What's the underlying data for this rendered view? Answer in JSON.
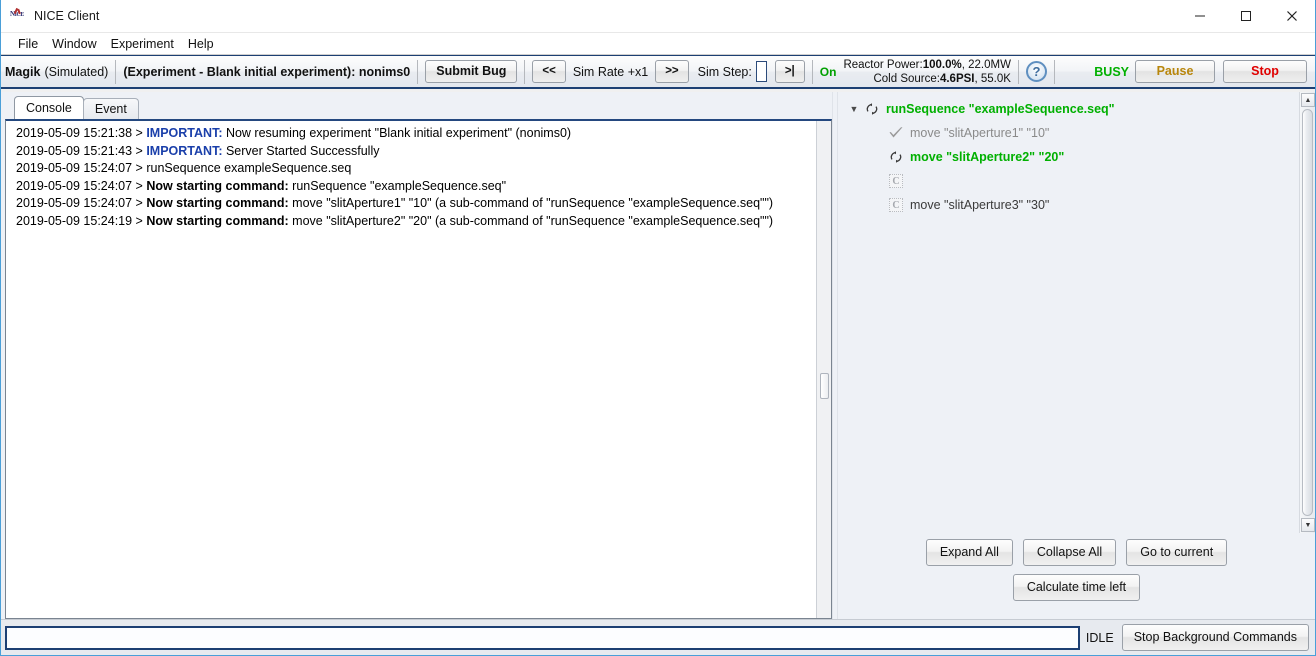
{
  "window": {
    "title": "NICE Client",
    "app_icon": "nice-logo-icon",
    "controls": {
      "minimize": "minimize-icon",
      "maximize": "maximize-icon",
      "close": "close-icon"
    }
  },
  "menubar": {
    "items": [
      "File",
      "Window",
      "Experiment",
      "Help"
    ]
  },
  "toolbar": {
    "instrument_name": "Magik",
    "instrument_mode": "(Simulated)",
    "experiment": "(Experiment - Blank initial experiment): nonims0",
    "submit_bug_label": "Submit Bug",
    "rate_back_label": "<<",
    "sim_rate_label": "Sim Rate +x1",
    "rate_fwd_label": ">>",
    "sim_step_label": "Sim Step:",
    "sim_step_value": "",
    "step_once_label": ">|",
    "on_status": "On",
    "reactor_power_label": "Reactor Power:",
    "reactor_power_value": "100.0%",
    "reactor_power_extra": ", 22.0MW",
    "cold_source_label": "Cold Source:",
    "cold_source_value": "4.6PSI",
    "cold_source_extra": ", 55.0K",
    "help_icon": "?",
    "busy_status": "BUSY",
    "pause_label": "Pause",
    "stop_label": "Stop",
    "colors": {
      "on": "#00a000",
      "busy": "#00b000",
      "pause": "#b8860b",
      "stop": "#e00000"
    }
  },
  "console": {
    "tabs": [
      {
        "label": "Console",
        "selected": true
      },
      {
        "label": "Event",
        "selected": false
      }
    ],
    "lines": [
      {
        "timestamp": "2019-05-09 15:21:38 > ",
        "tag": "IMPORTANT:",
        "bold": "",
        "rest": " Now resuming experiment \"Blank initial experiment\" (nonims0)"
      },
      {
        "timestamp": "2019-05-09 15:21:43 > ",
        "tag": "IMPORTANT:",
        "bold": "",
        "rest": " Server Started Successfully"
      },
      {
        "timestamp": "2019-05-09 15:24:07 > ",
        "tag": "",
        "bold": "",
        "rest": "runSequence exampleSequence.seq"
      },
      {
        "timestamp": "2019-05-09 15:24:07 > ",
        "tag": "",
        "bold": "Now starting command:",
        "rest": " runSequence \"exampleSequence.seq\""
      },
      {
        "timestamp": "2019-05-09 15:24:07 > ",
        "tag": "",
        "bold": "Now starting command:",
        "rest": " move \"slitAperture1\" \"10\" (a sub-command of \"runSequence \"exampleSequence.seq\"\")"
      },
      {
        "timestamp": "2019-05-09 15:24:19 > ",
        "tag": "",
        "bold": "Now starting command:",
        "rest": " move \"slitAperture2\" \"20\" (a sub-command of \"runSequence \"exampleSequence.seq\"\")"
      }
    ]
  },
  "tree": {
    "rows": [
      {
        "indent": 1,
        "twisty": "▼",
        "icon": "running-spinner-icon",
        "label": "runSequence \"exampleSequence.seq\"",
        "state": "running"
      },
      {
        "indent": 2,
        "twisty": "",
        "icon": "check-done-icon",
        "label": "move \"slitAperture1\" \"10\"",
        "state": "done"
      },
      {
        "indent": 2,
        "twisty": "",
        "icon": "running-spinner-icon",
        "label": "move \"slitAperture2\" \"20\"",
        "state": "running"
      },
      {
        "indent": 2,
        "twisty": "",
        "icon": "pending-command-icon",
        "label": "",
        "state": "pending"
      },
      {
        "indent": 2,
        "twisty": "",
        "icon": "pending-command-icon",
        "label": "move \"slitAperture3\" \"30\"",
        "state": "pending"
      }
    ],
    "buttons": {
      "expand_all": "Expand All",
      "collapse_all": "Collapse All",
      "go_to_current": "Go to current",
      "calculate_time_left": "Calculate time left"
    }
  },
  "bottombar": {
    "command_input_value": "",
    "command_input_placeholder": "",
    "idle_status": "IDLE",
    "stop_background_label": "Stop Background Commands"
  }
}
